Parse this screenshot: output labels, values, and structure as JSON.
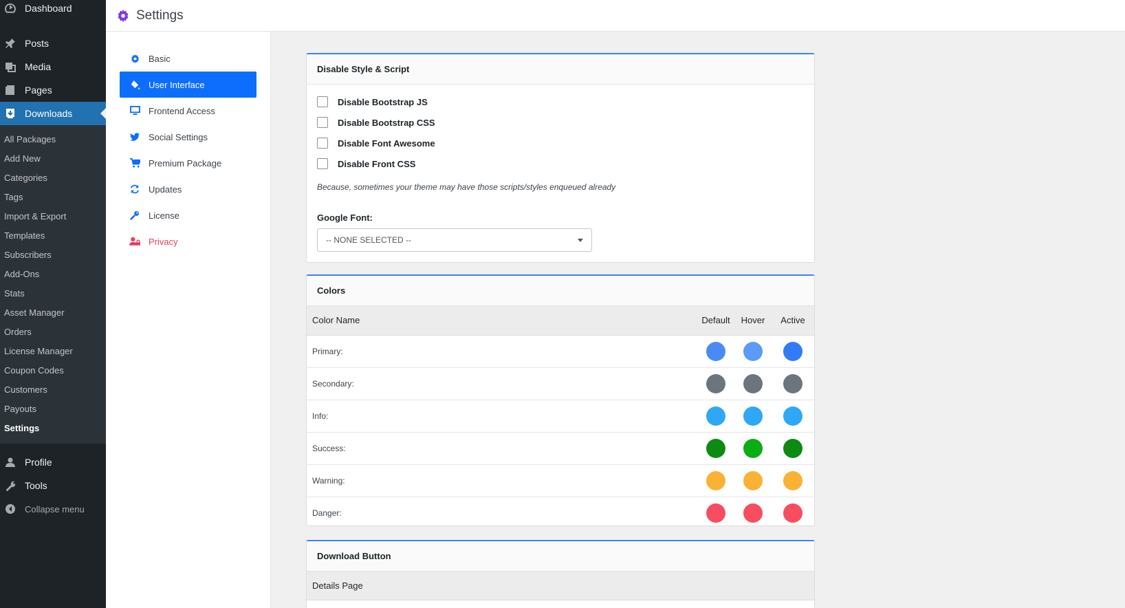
{
  "wp_menu": {
    "dashboard": "Dashboard",
    "posts": "Posts",
    "media": "Media",
    "pages": "Pages",
    "downloads": "Downloads",
    "submenu": [
      "All Packages",
      "Add New",
      "Categories",
      "Tags",
      "Import & Export",
      "Templates",
      "Subscribers",
      "Add-Ons",
      "Stats",
      "Asset Manager",
      "Orders",
      "License Manager",
      "Coupon Codes",
      "Customers",
      "Payouts",
      "Settings"
    ],
    "profile": "Profile",
    "tools": "Tools",
    "collapse": "Collapse menu"
  },
  "header": {
    "title": "Settings"
  },
  "settings_nav": [
    {
      "label": "Basic",
      "icon": "gear-icon"
    },
    {
      "label": "User Interface",
      "icon": "paint-bucket-icon"
    },
    {
      "label": "Frontend Access",
      "icon": "desktop-icon"
    },
    {
      "label": "Social Settings",
      "icon": "twitter-icon"
    },
    {
      "label": "Premium Package",
      "icon": "cart-icon"
    },
    {
      "label": "Updates",
      "icon": "refresh-icon"
    },
    {
      "label": "License",
      "icon": "key-icon"
    },
    {
      "label": "Privacy",
      "icon": "user-lock-icon"
    }
  ],
  "style_script": {
    "title": "Disable Style & Script",
    "options": [
      "Disable Bootstrap JS",
      "Disable Bootstrap CSS",
      "Disable Font Awesome",
      "Disable Front CSS"
    ],
    "note": "Because, sometimes your theme may have those scripts/styles enqueued already",
    "google_font_label": "Google Font:",
    "google_font_value": "-- NONE SELECTED --"
  },
  "colors": {
    "title": "Colors",
    "headers": {
      "name": "Color Name",
      "default": "Default",
      "hover": "Hover",
      "active": "Active"
    },
    "rows": [
      {
        "name": "Primary:",
        "default": "#4a8af4",
        "hover": "#5b9af5",
        "active": "#2f7cf6"
      },
      {
        "name": "Secondary:",
        "default": "#6c757d",
        "hover": "#6c757d",
        "active": "#6c757d"
      },
      {
        "name": "Info:",
        "default": "#2ea8f5",
        "hover": "#2ea8f5",
        "active": "#2ea8f5"
      },
      {
        "name": "Success:",
        "default": "#0c8a12",
        "hover": "#0aad14",
        "active": "#0c8a12"
      },
      {
        "name": "Warning:",
        "default": "#f9b234",
        "hover": "#f9b234",
        "active": "#f9b234"
      },
      {
        "name": "Danger:",
        "default": "#f74d5f",
        "hover": "#f74d5f",
        "active": "#f74d5f"
      }
    ]
  },
  "download_button": {
    "title": "Download Button",
    "sub": "Details Page"
  }
}
